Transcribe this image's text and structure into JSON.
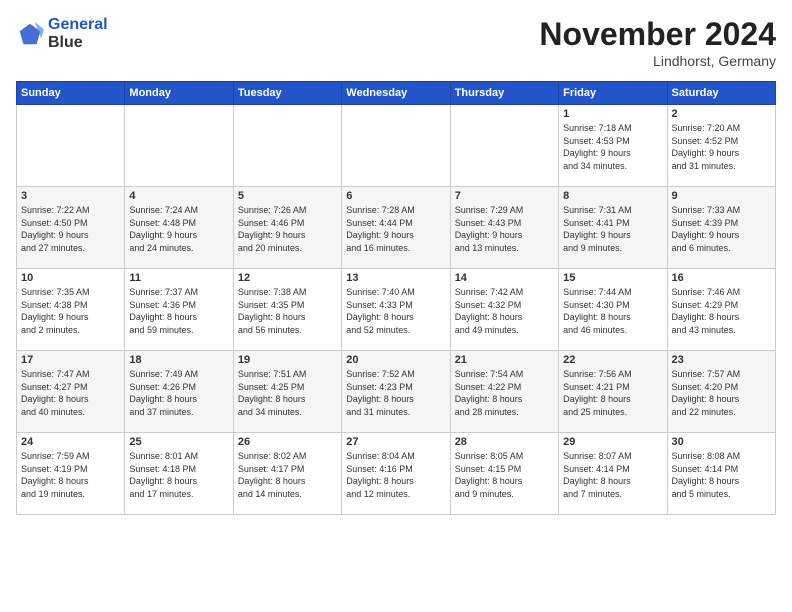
{
  "header": {
    "logo_line1": "General",
    "logo_line2": "Blue",
    "month": "November 2024",
    "location": "Lindhorst, Germany"
  },
  "weekdays": [
    "Sunday",
    "Monday",
    "Tuesday",
    "Wednesday",
    "Thursday",
    "Friday",
    "Saturday"
  ],
  "weeks": [
    [
      {
        "day": "",
        "info": ""
      },
      {
        "day": "",
        "info": ""
      },
      {
        "day": "",
        "info": ""
      },
      {
        "day": "",
        "info": ""
      },
      {
        "day": "",
        "info": ""
      },
      {
        "day": "1",
        "info": "Sunrise: 7:18 AM\nSunset: 4:53 PM\nDaylight: 9 hours\nand 34 minutes."
      },
      {
        "day": "2",
        "info": "Sunrise: 7:20 AM\nSunset: 4:52 PM\nDaylight: 9 hours\nand 31 minutes."
      }
    ],
    [
      {
        "day": "3",
        "info": "Sunrise: 7:22 AM\nSunset: 4:50 PM\nDaylight: 9 hours\nand 27 minutes."
      },
      {
        "day": "4",
        "info": "Sunrise: 7:24 AM\nSunset: 4:48 PM\nDaylight: 9 hours\nand 24 minutes."
      },
      {
        "day": "5",
        "info": "Sunrise: 7:26 AM\nSunset: 4:46 PM\nDaylight: 9 hours\nand 20 minutes."
      },
      {
        "day": "6",
        "info": "Sunrise: 7:28 AM\nSunset: 4:44 PM\nDaylight: 9 hours\nand 16 minutes."
      },
      {
        "day": "7",
        "info": "Sunrise: 7:29 AM\nSunset: 4:43 PM\nDaylight: 9 hours\nand 13 minutes."
      },
      {
        "day": "8",
        "info": "Sunrise: 7:31 AM\nSunset: 4:41 PM\nDaylight: 9 hours\nand 9 minutes."
      },
      {
        "day": "9",
        "info": "Sunrise: 7:33 AM\nSunset: 4:39 PM\nDaylight: 9 hours\nand 6 minutes."
      }
    ],
    [
      {
        "day": "10",
        "info": "Sunrise: 7:35 AM\nSunset: 4:38 PM\nDaylight: 9 hours\nand 2 minutes."
      },
      {
        "day": "11",
        "info": "Sunrise: 7:37 AM\nSunset: 4:36 PM\nDaylight: 8 hours\nand 59 minutes."
      },
      {
        "day": "12",
        "info": "Sunrise: 7:38 AM\nSunset: 4:35 PM\nDaylight: 8 hours\nand 56 minutes."
      },
      {
        "day": "13",
        "info": "Sunrise: 7:40 AM\nSunset: 4:33 PM\nDaylight: 8 hours\nand 52 minutes."
      },
      {
        "day": "14",
        "info": "Sunrise: 7:42 AM\nSunset: 4:32 PM\nDaylight: 8 hours\nand 49 minutes."
      },
      {
        "day": "15",
        "info": "Sunrise: 7:44 AM\nSunset: 4:30 PM\nDaylight: 8 hours\nand 46 minutes."
      },
      {
        "day": "16",
        "info": "Sunrise: 7:46 AM\nSunset: 4:29 PM\nDaylight: 8 hours\nand 43 minutes."
      }
    ],
    [
      {
        "day": "17",
        "info": "Sunrise: 7:47 AM\nSunset: 4:27 PM\nDaylight: 8 hours\nand 40 minutes."
      },
      {
        "day": "18",
        "info": "Sunrise: 7:49 AM\nSunset: 4:26 PM\nDaylight: 8 hours\nand 37 minutes."
      },
      {
        "day": "19",
        "info": "Sunrise: 7:51 AM\nSunset: 4:25 PM\nDaylight: 8 hours\nand 34 minutes."
      },
      {
        "day": "20",
        "info": "Sunrise: 7:52 AM\nSunset: 4:23 PM\nDaylight: 8 hours\nand 31 minutes."
      },
      {
        "day": "21",
        "info": "Sunrise: 7:54 AM\nSunset: 4:22 PM\nDaylight: 8 hours\nand 28 minutes."
      },
      {
        "day": "22",
        "info": "Sunrise: 7:56 AM\nSunset: 4:21 PM\nDaylight: 8 hours\nand 25 minutes."
      },
      {
        "day": "23",
        "info": "Sunrise: 7:57 AM\nSunset: 4:20 PM\nDaylight: 8 hours\nand 22 minutes."
      }
    ],
    [
      {
        "day": "24",
        "info": "Sunrise: 7:59 AM\nSunset: 4:19 PM\nDaylight: 8 hours\nand 19 minutes."
      },
      {
        "day": "25",
        "info": "Sunrise: 8:01 AM\nSunset: 4:18 PM\nDaylight: 8 hours\nand 17 minutes."
      },
      {
        "day": "26",
        "info": "Sunrise: 8:02 AM\nSunset: 4:17 PM\nDaylight: 8 hours\nand 14 minutes."
      },
      {
        "day": "27",
        "info": "Sunrise: 8:04 AM\nSunset: 4:16 PM\nDaylight: 8 hours\nand 12 minutes."
      },
      {
        "day": "28",
        "info": "Sunrise: 8:05 AM\nSunset: 4:15 PM\nDaylight: 8 hours\nand 9 minutes."
      },
      {
        "day": "29",
        "info": "Sunrise: 8:07 AM\nSunset: 4:14 PM\nDaylight: 8 hours\nand 7 minutes."
      },
      {
        "day": "30",
        "info": "Sunrise: 8:08 AM\nSunset: 4:14 PM\nDaylight: 8 hours\nand 5 minutes."
      }
    ]
  ]
}
